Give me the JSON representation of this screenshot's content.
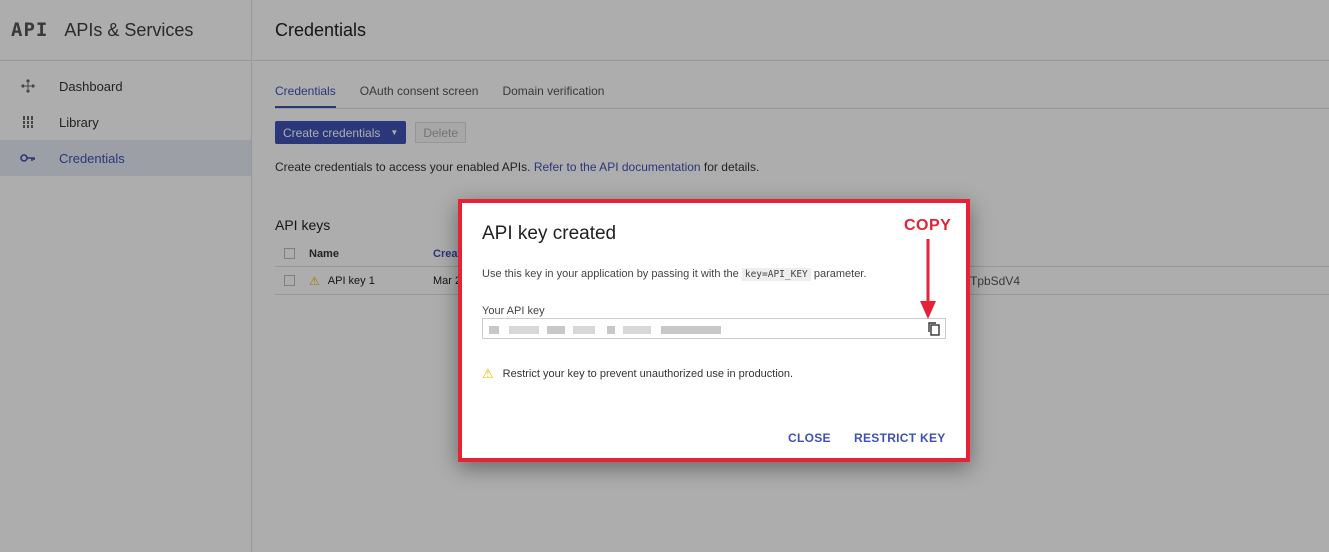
{
  "sidebar": {
    "logo": "API",
    "title": "APIs & Services",
    "items": [
      {
        "label": "Dashboard",
        "icon": "dashboard-icon"
      },
      {
        "label": "Library",
        "icon": "library-icon"
      },
      {
        "label": "Credentials",
        "icon": "key-icon",
        "active": true
      }
    ]
  },
  "header": {
    "title": "Credentials"
  },
  "tabs": [
    "Credentials",
    "OAuth consent screen",
    "Domain verification"
  ],
  "actions": {
    "create_label": "Create credentials",
    "delete_label": "Delete"
  },
  "info": {
    "text_before": "Create credentials to access your enabled APIs. ",
    "link": "Refer to the API documentation",
    "text_after": " for details."
  },
  "api_keys": {
    "title": "API keys",
    "columns": {
      "name": "Name",
      "created": "Creat"
    },
    "rows": [
      {
        "name": "API key 1",
        "created": "Mar 2",
        "key_tail": "TpbSdV4"
      }
    ]
  },
  "dialog": {
    "title": "API key created",
    "desc_before": "Use this key in your application by passing it with the ",
    "desc_code": "key=API_KEY",
    "desc_after": " parameter.",
    "key_label": "Your API key",
    "restrict_note": "Restrict your key to prevent unauthorized use in production.",
    "close_label": "CLOSE",
    "restrict_label": "RESTRICT KEY",
    "annotation": "COPY"
  },
  "colors": {
    "accent": "#3f51b5",
    "annotation": "#e52236",
    "warning": "#f4b400"
  }
}
